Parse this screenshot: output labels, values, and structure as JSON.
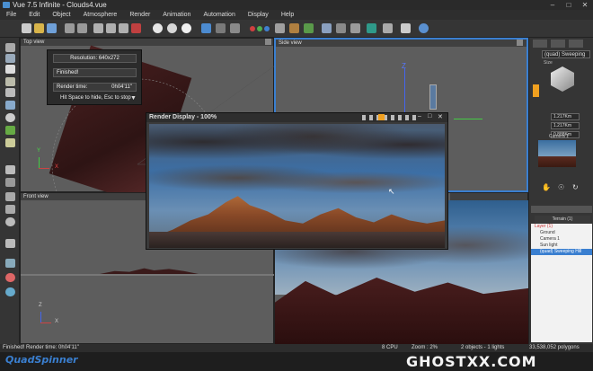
{
  "window": {
    "title": "Vue 7.5 Infinite - Clouds4.vue"
  },
  "menu": [
    "File",
    "Edit",
    "Object",
    "Atmosphere",
    "Render",
    "Animation",
    "Automation",
    "Display",
    "Help"
  ],
  "viewports": {
    "top": "Top view",
    "side": "Side view",
    "front": "Front view"
  },
  "render_info": {
    "resolution": "Resolution: 640x272",
    "status": "Finished!",
    "render_time_label": "Render time:",
    "render_time_value": "0h04'11\"",
    "hint": "Hit Space to hide, Esc to stop"
  },
  "render_display": {
    "title": "Render Display - 100%"
  },
  "right_panel": {
    "object_name": "(quad) Sweeping",
    "size_label": "Size",
    "values": [
      "1.217Km",
      "1.217Km",
      "0.888Km"
    ],
    "camera_label": "Camera 1",
    "terrain_tab": "Terrain (1)",
    "tree": [
      {
        "label": "Layer (1)",
        "indent": 0
      },
      {
        "label": "Ground",
        "indent": 1
      },
      {
        "label": "Camera 1",
        "indent": 1
      },
      {
        "label": "Sun light",
        "indent": 1
      },
      {
        "label": "(quad) Sweeping Hill",
        "indent": 1
      }
    ]
  },
  "status": {
    "left": "Finished! Render time: 0h04'11\"",
    "cpu": "8 CPU",
    "zoom": "Zoom : 2%",
    "objects": "2 objects - 1 lights",
    "polygons": "33,538,052 polygons"
  },
  "watermarks": {
    "left": "QuadSpinner",
    "right": "GHOSTXX.COM"
  },
  "axis_labels": {
    "x": "X",
    "y": "Y",
    "z": "Z"
  },
  "colors": {
    "accent": "#3a7fd0",
    "highlight": "#f0a020",
    "render_sky": "#3c6fa6"
  }
}
